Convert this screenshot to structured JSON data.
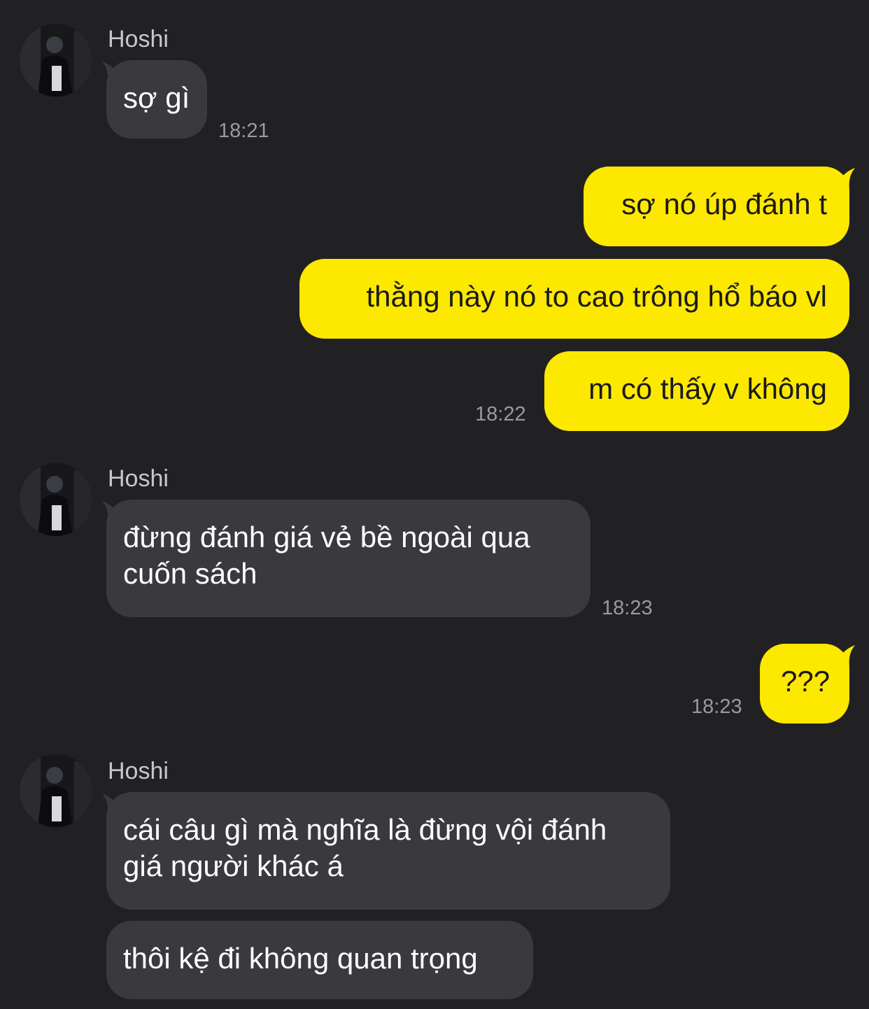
{
  "theme": {
    "background": "#212124",
    "incoming_bubble": "#3a3a3e",
    "outgoing_bubble": "#fde800",
    "timestamp_color": "#9a9a9e"
  },
  "groups": [
    {
      "sender": "Hoshi",
      "messages": [
        "sợ gì"
      ],
      "time": "18:21"
    },
    {
      "sender": "",
      "messages": [
        "sợ nó úp đánh t",
        "thằng này nó to cao trông hổ báo vl",
        "m có thấy v không"
      ],
      "time": "18:22"
    },
    {
      "sender": "Hoshi",
      "messages": [
        "đừng đánh giá vẻ bề ngoài qua",
        "cuốn sách"
      ],
      "time": "18:23"
    },
    {
      "sender": "",
      "messages": [
        "???"
      ],
      "time": "18:23"
    },
    {
      "sender": "Hoshi",
      "messages": [
        "cái câu gì mà nghĩa là đừng vội đánh",
        "giá người khác á",
        "thôi kệ đi không quan trọng"
      ]
    }
  ]
}
